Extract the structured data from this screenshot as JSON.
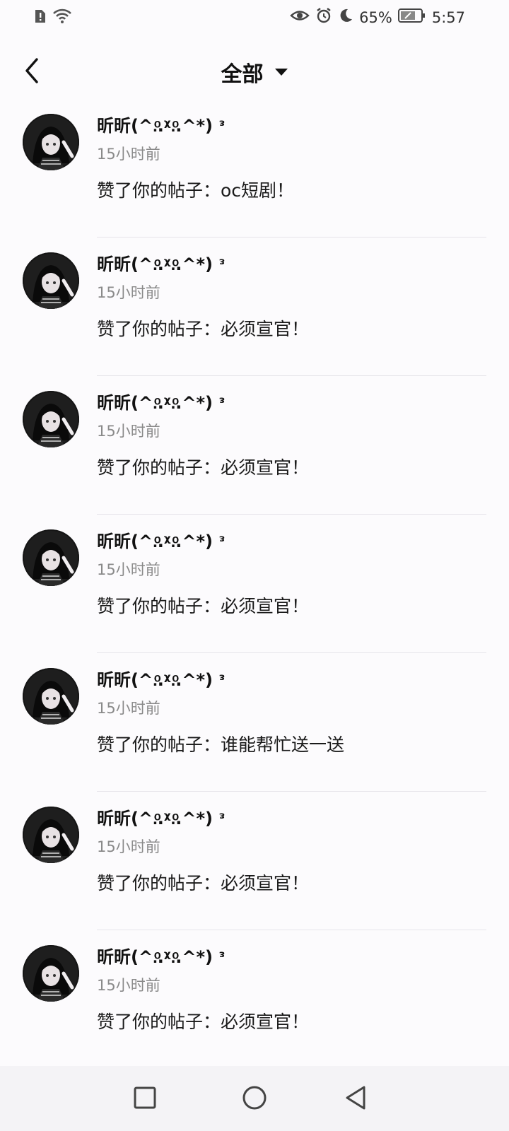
{
  "status_bar": {
    "battery": "65%",
    "time": "5:57",
    "icons": [
      "alert-sim-icon",
      "wifi-icon",
      "eye-icon",
      "alarm-icon",
      "moon-icon",
      "battery-icon"
    ]
  },
  "header": {
    "title": "全部",
    "back_icon": "chevron-left-icon",
    "dropdown_icon": "caret-down-icon"
  },
  "notifications": [
    {
      "user": "昕昕(^.ͦ.ᵡ.ͦ.^*) ᵌ",
      "time": "15小时前",
      "message": "赞了你的帖子：oc短剧！"
    },
    {
      "user": "昕昕(^.ͦ.ᵡ.ͦ.^*) ᵌ",
      "time": "15小时前",
      "message": "赞了你的帖子：必须宣官！"
    },
    {
      "user": "昕昕(^.ͦ.ᵡ.ͦ.^*) ᵌ",
      "time": "15小时前",
      "message": "赞了你的帖子：必须宣官！"
    },
    {
      "user": "昕昕(^.ͦ.ᵡ.ͦ.^*) ᵌ",
      "time": "15小时前",
      "message": "赞了你的帖子：必须宣官！"
    },
    {
      "user": "昕昕(^.ͦ.ᵡ.ͦ.^*) ᵌ",
      "time": "15小时前",
      "message": "赞了你的帖子：谁能帮忙送一送"
    },
    {
      "user": "昕昕(^.ͦ.ᵡ.ͦ.^*) ᵌ",
      "time": "15小时前",
      "message": "赞了你的帖子：必须宣官！"
    },
    {
      "user": "昕昕(^.ͦ.ᵡ.ͦ.^*) ᵌ",
      "time": "15小时前",
      "message": "赞了你的帖子：必须宣官！"
    }
  ],
  "nav_bar": {
    "icons": [
      "recents-square-icon",
      "home-circle-icon",
      "back-triangle-icon"
    ]
  }
}
